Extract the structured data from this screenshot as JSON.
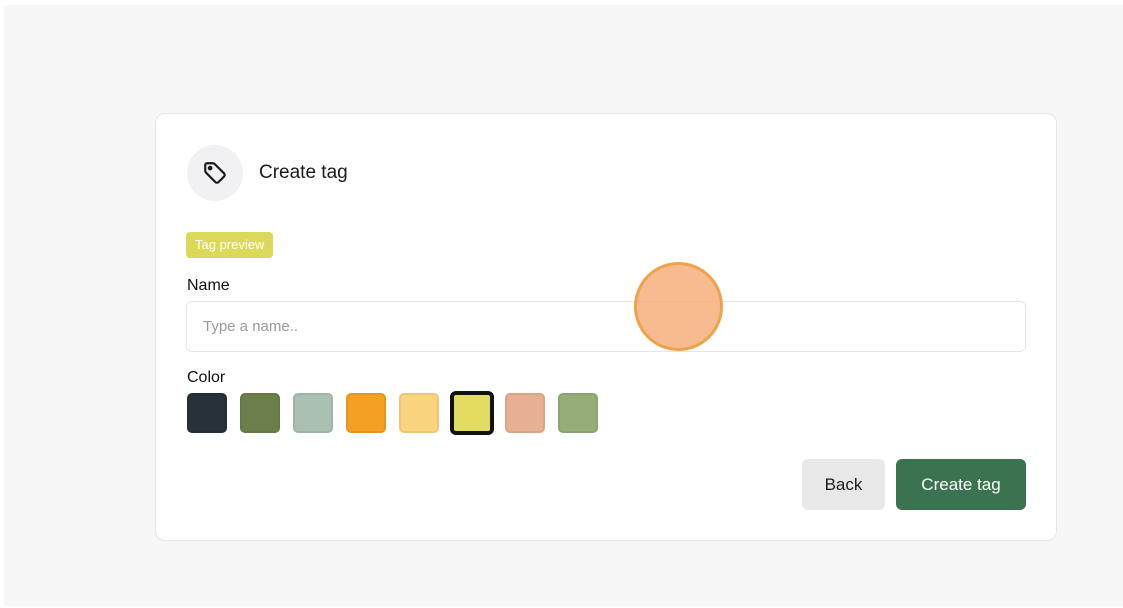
{
  "header": {
    "title": "Create tag",
    "icon": "tag-icon"
  },
  "tag_preview": {
    "label": "Tag preview",
    "color": "#dcd95a"
  },
  "name_field": {
    "label": "Name",
    "value": "",
    "placeholder": "Type a name.."
  },
  "color_field": {
    "label": "Color",
    "options": [
      {
        "name": "dark-slate",
        "hex": "#263238",
        "selected": false
      },
      {
        "name": "olive-green",
        "hex": "#6b7f4a",
        "selected": false
      },
      {
        "name": "sage",
        "hex": "#a9c0b3",
        "selected": false
      },
      {
        "name": "orange",
        "hex": "#f4a024",
        "selected": false
      },
      {
        "name": "light-amber",
        "hex": "#fbd47e",
        "selected": false
      },
      {
        "name": "yellow",
        "hex": "#e2dc60",
        "selected": true
      },
      {
        "name": "peach",
        "hex": "#e7b092",
        "selected": false
      },
      {
        "name": "moss",
        "hex": "#97ad78",
        "selected": false
      }
    ]
  },
  "actions": {
    "back_label": "Back",
    "create_label": "Create tag",
    "create_color": "#3b7350"
  }
}
